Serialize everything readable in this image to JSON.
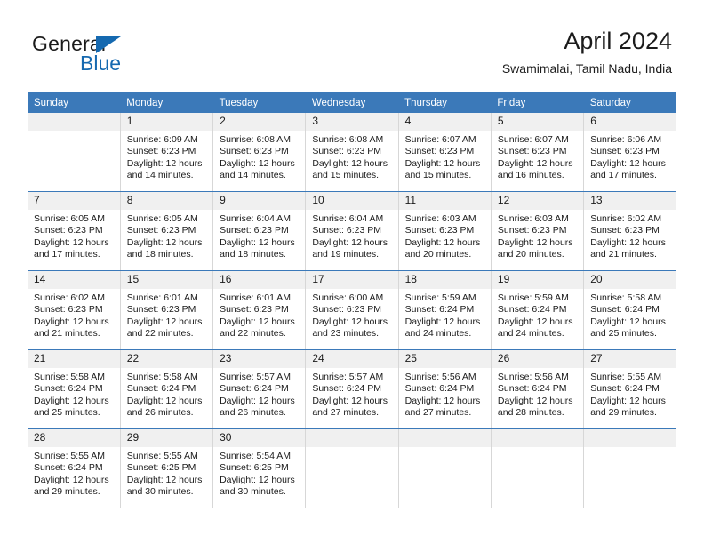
{
  "brand": {
    "name_dark": "General",
    "name_blue": "Blue",
    "accent_color": "#1569b0"
  },
  "header": {
    "title": "April 2024",
    "subtitle": "Swamimalai, Tamil Nadu, India",
    "header_bg_color": "#3b79b9",
    "daynum_bg_color": "#f0f0f0"
  },
  "weekdays": [
    "Sunday",
    "Monday",
    "Tuesday",
    "Wednesday",
    "Thursday",
    "Friday",
    "Saturday"
  ],
  "labels": {
    "sunrise": "Sunrise:",
    "sunset": "Sunset:",
    "daylight": "Daylight:"
  },
  "weeks": [
    [
      {
        "day": "",
        "blank": true
      },
      {
        "day": "1",
        "sunrise": "Sunrise: 6:09 AM",
        "sunset": "Sunset: 6:23 PM",
        "daylight1": "Daylight: 12 hours",
        "daylight2": "and 14 minutes."
      },
      {
        "day": "2",
        "sunrise": "Sunrise: 6:08 AM",
        "sunset": "Sunset: 6:23 PM",
        "daylight1": "Daylight: 12 hours",
        "daylight2": "and 14 minutes."
      },
      {
        "day": "3",
        "sunrise": "Sunrise: 6:08 AM",
        "sunset": "Sunset: 6:23 PM",
        "daylight1": "Daylight: 12 hours",
        "daylight2": "and 15 minutes."
      },
      {
        "day": "4",
        "sunrise": "Sunrise: 6:07 AM",
        "sunset": "Sunset: 6:23 PM",
        "daylight1": "Daylight: 12 hours",
        "daylight2": "and 15 minutes."
      },
      {
        "day": "5",
        "sunrise": "Sunrise: 6:07 AM",
        "sunset": "Sunset: 6:23 PM",
        "daylight1": "Daylight: 12 hours",
        "daylight2": "and 16 minutes."
      },
      {
        "day": "6",
        "sunrise": "Sunrise: 6:06 AM",
        "sunset": "Sunset: 6:23 PM",
        "daylight1": "Daylight: 12 hours",
        "daylight2": "and 17 minutes."
      }
    ],
    [
      {
        "day": "7",
        "sunrise": "Sunrise: 6:05 AM",
        "sunset": "Sunset: 6:23 PM",
        "daylight1": "Daylight: 12 hours",
        "daylight2": "and 17 minutes."
      },
      {
        "day": "8",
        "sunrise": "Sunrise: 6:05 AM",
        "sunset": "Sunset: 6:23 PM",
        "daylight1": "Daylight: 12 hours",
        "daylight2": "and 18 minutes."
      },
      {
        "day": "9",
        "sunrise": "Sunrise: 6:04 AM",
        "sunset": "Sunset: 6:23 PM",
        "daylight1": "Daylight: 12 hours",
        "daylight2": "and 18 minutes."
      },
      {
        "day": "10",
        "sunrise": "Sunrise: 6:04 AM",
        "sunset": "Sunset: 6:23 PM",
        "daylight1": "Daylight: 12 hours",
        "daylight2": "and 19 minutes."
      },
      {
        "day": "11",
        "sunrise": "Sunrise: 6:03 AM",
        "sunset": "Sunset: 6:23 PM",
        "daylight1": "Daylight: 12 hours",
        "daylight2": "and 20 minutes."
      },
      {
        "day": "12",
        "sunrise": "Sunrise: 6:03 AM",
        "sunset": "Sunset: 6:23 PM",
        "daylight1": "Daylight: 12 hours",
        "daylight2": "and 20 minutes."
      },
      {
        "day": "13",
        "sunrise": "Sunrise: 6:02 AM",
        "sunset": "Sunset: 6:23 PM",
        "daylight1": "Daylight: 12 hours",
        "daylight2": "and 21 minutes."
      }
    ],
    [
      {
        "day": "14",
        "sunrise": "Sunrise: 6:02 AM",
        "sunset": "Sunset: 6:23 PM",
        "daylight1": "Daylight: 12 hours",
        "daylight2": "and 21 minutes."
      },
      {
        "day": "15",
        "sunrise": "Sunrise: 6:01 AM",
        "sunset": "Sunset: 6:23 PM",
        "daylight1": "Daylight: 12 hours",
        "daylight2": "and 22 minutes."
      },
      {
        "day": "16",
        "sunrise": "Sunrise: 6:01 AM",
        "sunset": "Sunset: 6:23 PM",
        "daylight1": "Daylight: 12 hours",
        "daylight2": "and 22 minutes."
      },
      {
        "day": "17",
        "sunrise": "Sunrise: 6:00 AM",
        "sunset": "Sunset: 6:23 PM",
        "daylight1": "Daylight: 12 hours",
        "daylight2": "and 23 minutes."
      },
      {
        "day": "18",
        "sunrise": "Sunrise: 5:59 AM",
        "sunset": "Sunset: 6:24 PM",
        "daylight1": "Daylight: 12 hours",
        "daylight2": "and 24 minutes."
      },
      {
        "day": "19",
        "sunrise": "Sunrise: 5:59 AM",
        "sunset": "Sunset: 6:24 PM",
        "daylight1": "Daylight: 12 hours",
        "daylight2": "and 24 minutes."
      },
      {
        "day": "20",
        "sunrise": "Sunrise: 5:58 AM",
        "sunset": "Sunset: 6:24 PM",
        "daylight1": "Daylight: 12 hours",
        "daylight2": "and 25 minutes."
      }
    ],
    [
      {
        "day": "21",
        "sunrise": "Sunrise: 5:58 AM",
        "sunset": "Sunset: 6:24 PM",
        "daylight1": "Daylight: 12 hours",
        "daylight2": "and 25 minutes."
      },
      {
        "day": "22",
        "sunrise": "Sunrise: 5:58 AM",
        "sunset": "Sunset: 6:24 PM",
        "daylight1": "Daylight: 12 hours",
        "daylight2": "and 26 minutes."
      },
      {
        "day": "23",
        "sunrise": "Sunrise: 5:57 AM",
        "sunset": "Sunset: 6:24 PM",
        "daylight1": "Daylight: 12 hours",
        "daylight2": "and 26 minutes."
      },
      {
        "day": "24",
        "sunrise": "Sunrise: 5:57 AM",
        "sunset": "Sunset: 6:24 PM",
        "daylight1": "Daylight: 12 hours",
        "daylight2": "and 27 minutes."
      },
      {
        "day": "25",
        "sunrise": "Sunrise: 5:56 AM",
        "sunset": "Sunset: 6:24 PM",
        "daylight1": "Daylight: 12 hours",
        "daylight2": "and 27 minutes."
      },
      {
        "day": "26",
        "sunrise": "Sunrise: 5:56 AM",
        "sunset": "Sunset: 6:24 PM",
        "daylight1": "Daylight: 12 hours",
        "daylight2": "and 28 minutes."
      },
      {
        "day": "27",
        "sunrise": "Sunrise: 5:55 AM",
        "sunset": "Sunset: 6:24 PM",
        "daylight1": "Daylight: 12 hours",
        "daylight2": "and 29 minutes."
      }
    ],
    [
      {
        "day": "28",
        "sunrise": "Sunrise: 5:55 AM",
        "sunset": "Sunset: 6:24 PM",
        "daylight1": "Daylight: 12 hours",
        "daylight2": "and 29 minutes."
      },
      {
        "day": "29",
        "sunrise": "Sunrise: 5:55 AM",
        "sunset": "Sunset: 6:25 PM",
        "daylight1": "Daylight: 12 hours",
        "daylight2": "and 30 minutes."
      },
      {
        "day": "30",
        "sunrise": "Sunrise: 5:54 AM",
        "sunset": "Sunset: 6:25 PM",
        "daylight1": "Daylight: 12 hours",
        "daylight2": "and 30 minutes."
      },
      {
        "day": "",
        "blank": true
      },
      {
        "day": "",
        "blank": true
      },
      {
        "day": "",
        "blank": true
      },
      {
        "day": "",
        "blank": true
      }
    ]
  ]
}
